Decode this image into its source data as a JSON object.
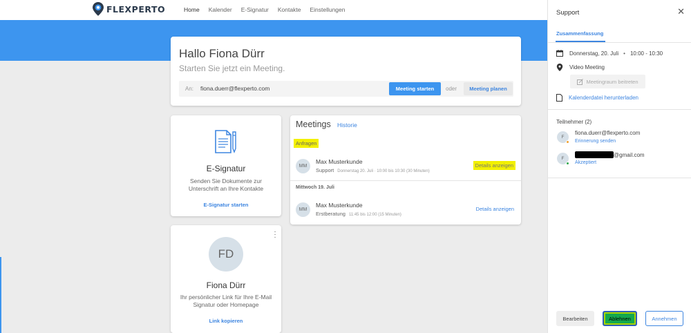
{
  "brand": {
    "name": "FLEXPERTO",
    "logo_icon": "flexperto-pin-logo",
    "accent": "#3d95ef"
  },
  "nav": {
    "items": [
      "Home",
      "Kalender",
      "E-Signatur",
      "Kontakte",
      "Einstellungen"
    ],
    "active": "Home"
  },
  "hello": {
    "title": "Hallo Fiona Dürr",
    "subtitle": "Starten Sie jetzt ein Meeting.",
    "to_label": "An:",
    "email": "fiona.duerr@flexperto.com",
    "start_button": "Meeting starten",
    "or": "oder",
    "plan_button": "Meeting planen"
  },
  "esignatur": {
    "icon": "document-pen-icon",
    "title": "E-Signatur",
    "description": "Senden Sie Dokumente zur Unterschrift an Ihre Kontakte",
    "link": "E-Signatur starten"
  },
  "profile": {
    "initials": "FD",
    "name": "Fiona Dürr",
    "description": "Ihr persönlicher Link für Ihre E-Mail Signatur oder Homepage",
    "link": "Link kopieren"
  },
  "meetings": {
    "title": "Meetings",
    "history": "Historie",
    "requests_label": "Anfragen",
    "date_header": "Mittwoch 19. Juli",
    "items": [
      {
        "initials": "MM",
        "name": "Max Musterkunde",
        "type": "Support",
        "time": "Donnerstag 20. Juli · 10:00 bis 10:30 (30 Minuten)",
        "action": "Details anzeigen"
      },
      {
        "initials": "MM",
        "name": "Max Musterkunde",
        "type": "Erstberatung",
        "time": "11:45 bis 12:00 (15 Minuten)",
        "action": "Details anzeigen"
      }
    ]
  },
  "panel": {
    "title": "Support",
    "tab": "Zusammenfassung",
    "date": "Donnerstag, 20. Juli",
    "time": "10:00 - 10:30",
    "location": "Video Meeting",
    "join_button": "Meetingraum beitreten",
    "calendar_link": "Kalenderdatei herunterladen",
    "participants_title": "Teilnehmer (2)",
    "participants": [
      {
        "initial": "F",
        "email": "fiona.duerr@flexperto.com",
        "status": "Erinnerung senden",
        "dot_color": "#f0a030"
      },
      {
        "initial": "F",
        "email": "@gmail.com",
        "status": "Akzeptiert",
        "dot_color": "#2ea84e"
      }
    ],
    "buttons": {
      "edit": "Bearbeiten",
      "reject": "Ablehnen",
      "accept": "Annehmen"
    }
  }
}
